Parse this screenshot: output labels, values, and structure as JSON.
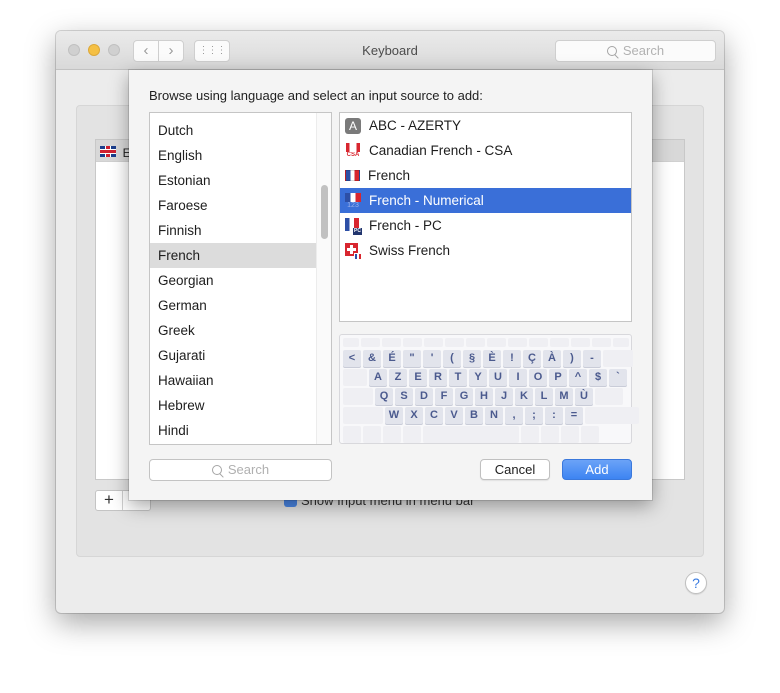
{
  "window": {
    "title": "Keyboard",
    "search_placeholder": "Search",
    "nav_back_icon": "‹",
    "nav_forward_icon": "›",
    "grid_icon": "⋮⋮⋮"
  },
  "background": {
    "list_first_item_icon": "uk-flag-icon",
    "list_first_item_text": "E",
    "add_symbol": "+",
    "checkbox_label": "Show Input menu in menu bar",
    "checkbox_checked": true,
    "help_symbol": "?"
  },
  "sheet": {
    "prompt": "Browse using language and select an input source to add:",
    "languages": [
      {
        "label": "Dutch",
        "selected": false
      },
      {
        "label": "English",
        "selected": false
      },
      {
        "label": "Estonian",
        "selected": false
      },
      {
        "label": "Faroese",
        "selected": false
      },
      {
        "label": "Finnish",
        "selected": false
      },
      {
        "label": "French",
        "selected": true
      },
      {
        "label": "Georgian",
        "selected": false
      },
      {
        "label": "German",
        "selected": false
      },
      {
        "label": "Greek",
        "selected": false
      },
      {
        "label": "Gujarati",
        "selected": false
      },
      {
        "label": "Hawaiian",
        "selected": false
      },
      {
        "label": "Hebrew",
        "selected": false
      },
      {
        "label": "Hindi",
        "selected": false
      }
    ],
    "sources": [
      {
        "label": "ABC - AZERTY",
        "icon": "abc-icon",
        "icon_text": "A",
        "selected": false
      },
      {
        "label": "Canadian French - CSA",
        "icon": "canada-flag-icon",
        "icon_text": "CSA",
        "selected": false
      },
      {
        "label": "French",
        "icon": "france-flag-icon",
        "selected": false
      },
      {
        "label": "French - Numerical",
        "icon": "france-numerical-flag-icon",
        "icon_text": "123",
        "selected": true
      },
      {
        "label": "French - PC",
        "icon": "france-pc-flag-icon",
        "icon_text": "PC",
        "selected": false
      },
      {
        "label": "Swiss French",
        "icon": "swiss-flag-icon",
        "selected": false
      }
    ],
    "keyboard": {
      "row1": [
        "<",
        "&",
        "É",
        "\"",
        "'",
        "(",
        "§",
        "È",
        "!",
        "Ç",
        "À",
        ")",
        "-"
      ],
      "row2": [
        "A",
        "Z",
        "E",
        "R",
        "T",
        "Y",
        "U",
        "I",
        "O",
        "P",
        "^",
        "$",
        "`"
      ],
      "row3": [
        "Q",
        "S",
        "D",
        "F",
        "G",
        "H",
        "J",
        "K",
        "L",
        "M",
        "Ù"
      ],
      "row4": [
        "W",
        "X",
        "C",
        "V",
        "B",
        "N",
        ",",
        ";",
        ":",
        "="
      ]
    },
    "search_placeholder": "Search",
    "cancel_label": "Cancel",
    "add_label": "Add"
  },
  "colors": {
    "selection_blue": "#3a6fd8",
    "add_button": "#3d84f2",
    "language_selected": "#dcdcdc",
    "key_text": "#4b5a8e"
  }
}
